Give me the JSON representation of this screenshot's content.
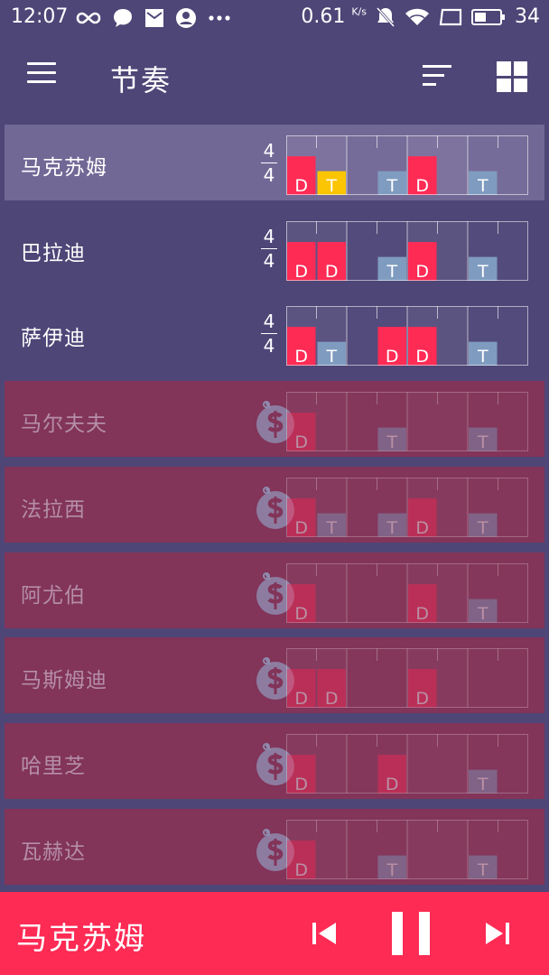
{
  "status": {
    "time": "12:07",
    "speed": "0.61",
    "speed_unit": "K/s",
    "battery": "34",
    "left_icons": [
      "infinity-icon",
      "chat-bubble-icon",
      "mail-icon",
      "account-icon",
      "more-dots-icon"
    ],
    "right_icons": [
      "bell-off-icon",
      "wifi-icon",
      "screen-icon",
      "battery-icon"
    ]
  },
  "appbar": {
    "title": "节奏"
  },
  "rhythms": [
    {
      "name": "马克苏姆",
      "time_sig": [
        "4",
        "4"
      ],
      "locked": false,
      "selected": true,
      "beats": [
        {
          "t": "D",
          "h": 0.65
        },
        {
          "t": "T",
          "h": 0.4
        },
        {
          "t": "",
          "h": 0
        },
        {
          "t": "T",
          "h": 0.4
        },
        {
          "t": "D",
          "h": 0.65
        },
        {
          "t": "",
          "h": 0
        },
        {
          "t": "T",
          "h": 0.4
        },
        {
          "t": "",
          "h": 0
        }
      ],
      "highlight": 1
    },
    {
      "name": "巴拉迪",
      "time_sig": [
        "4",
        "4"
      ],
      "locked": false,
      "selected": false,
      "beats": [
        {
          "t": "D",
          "h": 0.65
        },
        {
          "t": "D",
          "h": 0.65
        },
        {
          "t": "",
          "h": 0
        },
        {
          "t": "T",
          "h": 0.4
        },
        {
          "t": "D",
          "h": 0.65
        },
        {
          "t": "",
          "h": 0
        },
        {
          "t": "T",
          "h": 0.4
        },
        {
          "t": "",
          "h": 0
        }
      ],
      "highlight": -1
    },
    {
      "name": "萨伊迪",
      "time_sig": [
        "4",
        "4"
      ],
      "locked": false,
      "selected": false,
      "beats": [
        {
          "t": "D",
          "h": 0.65
        },
        {
          "t": "T",
          "h": 0.4
        },
        {
          "t": "",
          "h": 0
        },
        {
          "t": "D",
          "h": 0.65
        },
        {
          "t": "D",
          "h": 0.65
        },
        {
          "t": "",
          "h": 0
        },
        {
          "t": "T",
          "h": 0.4
        },
        {
          "t": "",
          "h": 0
        }
      ],
      "highlight": -1
    },
    {
      "name": "马尔夫夫",
      "locked": true,
      "selected": false,
      "beats": [
        {
          "t": "D",
          "h": 0.65
        },
        {
          "t": "",
          "h": 0
        },
        {
          "t": "",
          "h": 0
        },
        {
          "t": "T",
          "h": 0.4
        },
        {
          "t": "",
          "h": 0
        },
        {
          "t": "",
          "h": 0
        },
        {
          "t": "T",
          "h": 0.4
        },
        {
          "t": "",
          "h": 0
        }
      ],
      "highlight": -1
    },
    {
      "name": "法拉西",
      "locked": true,
      "selected": false,
      "beats": [
        {
          "t": "D",
          "h": 0.65
        },
        {
          "t": "T",
          "h": 0.4
        },
        {
          "t": "",
          "h": 0
        },
        {
          "t": "T",
          "h": 0.4
        },
        {
          "t": "D",
          "h": 0.65
        },
        {
          "t": "",
          "h": 0
        },
        {
          "t": "T",
          "h": 0.4
        },
        {
          "t": "",
          "h": 0
        }
      ],
      "highlight": -1
    },
    {
      "name": "阿尤伯",
      "locked": true,
      "selected": false,
      "beats": [
        {
          "t": "D",
          "h": 0.65
        },
        {
          "t": "",
          "h": 0
        },
        {
          "t": "",
          "h": 0
        },
        {
          "t": "",
          "h": 0
        },
        {
          "t": "D",
          "h": 0.65
        },
        {
          "t": "",
          "h": 0
        },
        {
          "t": "T",
          "h": 0.4
        },
        {
          "t": "",
          "h": 0
        }
      ],
      "highlight": -1
    },
    {
      "name": "马斯姆迪",
      "locked": true,
      "selected": false,
      "beats": [
        {
          "t": "D",
          "h": 0.65
        },
        {
          "t": "D",
          "h": 0.65
        },
        {
          "t": "",
          "h": 0
        },
        {
          "t": "",
          "h": 0
        },
        {
          "t": "D",
          "h": 0.65
        },
        {
          "t": "",
          "h": 0
        },
        {
          "t": "",
          "h": 0
        },
        {
          "t": "",
          "h": 0
        }
      ],
      "highlight": -1
    },
    {
      "name": "哈里芝",
      "locked": true,
      "selected": false,
      "beats": [
        {
          "t": "D",
          "h": 0.65
        },
        {
          "t": "",
          "h": 0
        },
        {
          "t": "",
          "h": 0
        },
        {
          "t": "D",
          "h": 0.65
        },
        {
          "t": "",
          "h": 0
        },
        {
          "t": "",
          "h": 0
        },
        {
          "t": "T",
          "h": 0.4
        },
        {
          "t": "",
          "h": 0
        }
      ],
      "highlight": -1
    },
    {
      "name": "瓦赫达",
      "locked": true,
      "selected": false,
      "beats": [
        {
          "t": "D",
          "h": 0.65
        },
        {
          "t": "",
          "h": 0
        },
        {
          "t": "",
          "h": 0
        },
        {
          "t": "T",
          "h": 0.4
        },
        {
          "t": "",
          "h": 0
        },
        {
          "t": "",
          "h": 0
        },
        {
          "t": "T",
          "h": 0.4
        },
        {
          "t": "",
          "h": 0
        }
      ],
      "highlight": -1
    }
  ],
  "player": {
    "now_playing": "马克苏姆",
    "controls": [
      "previous-icon",
      "pause-icon",
      "next-icon"
    ]
  },
  "colors": {
    "background": "#4e4677",
    "selected_row": "#726896",
    "locked_row": "#823459",
    "dum": "#fe2b55",
    "tek": "#7f9cc0",
    "highlight": "#fbc503",
    "player": "#fe2b55"
  }
}
